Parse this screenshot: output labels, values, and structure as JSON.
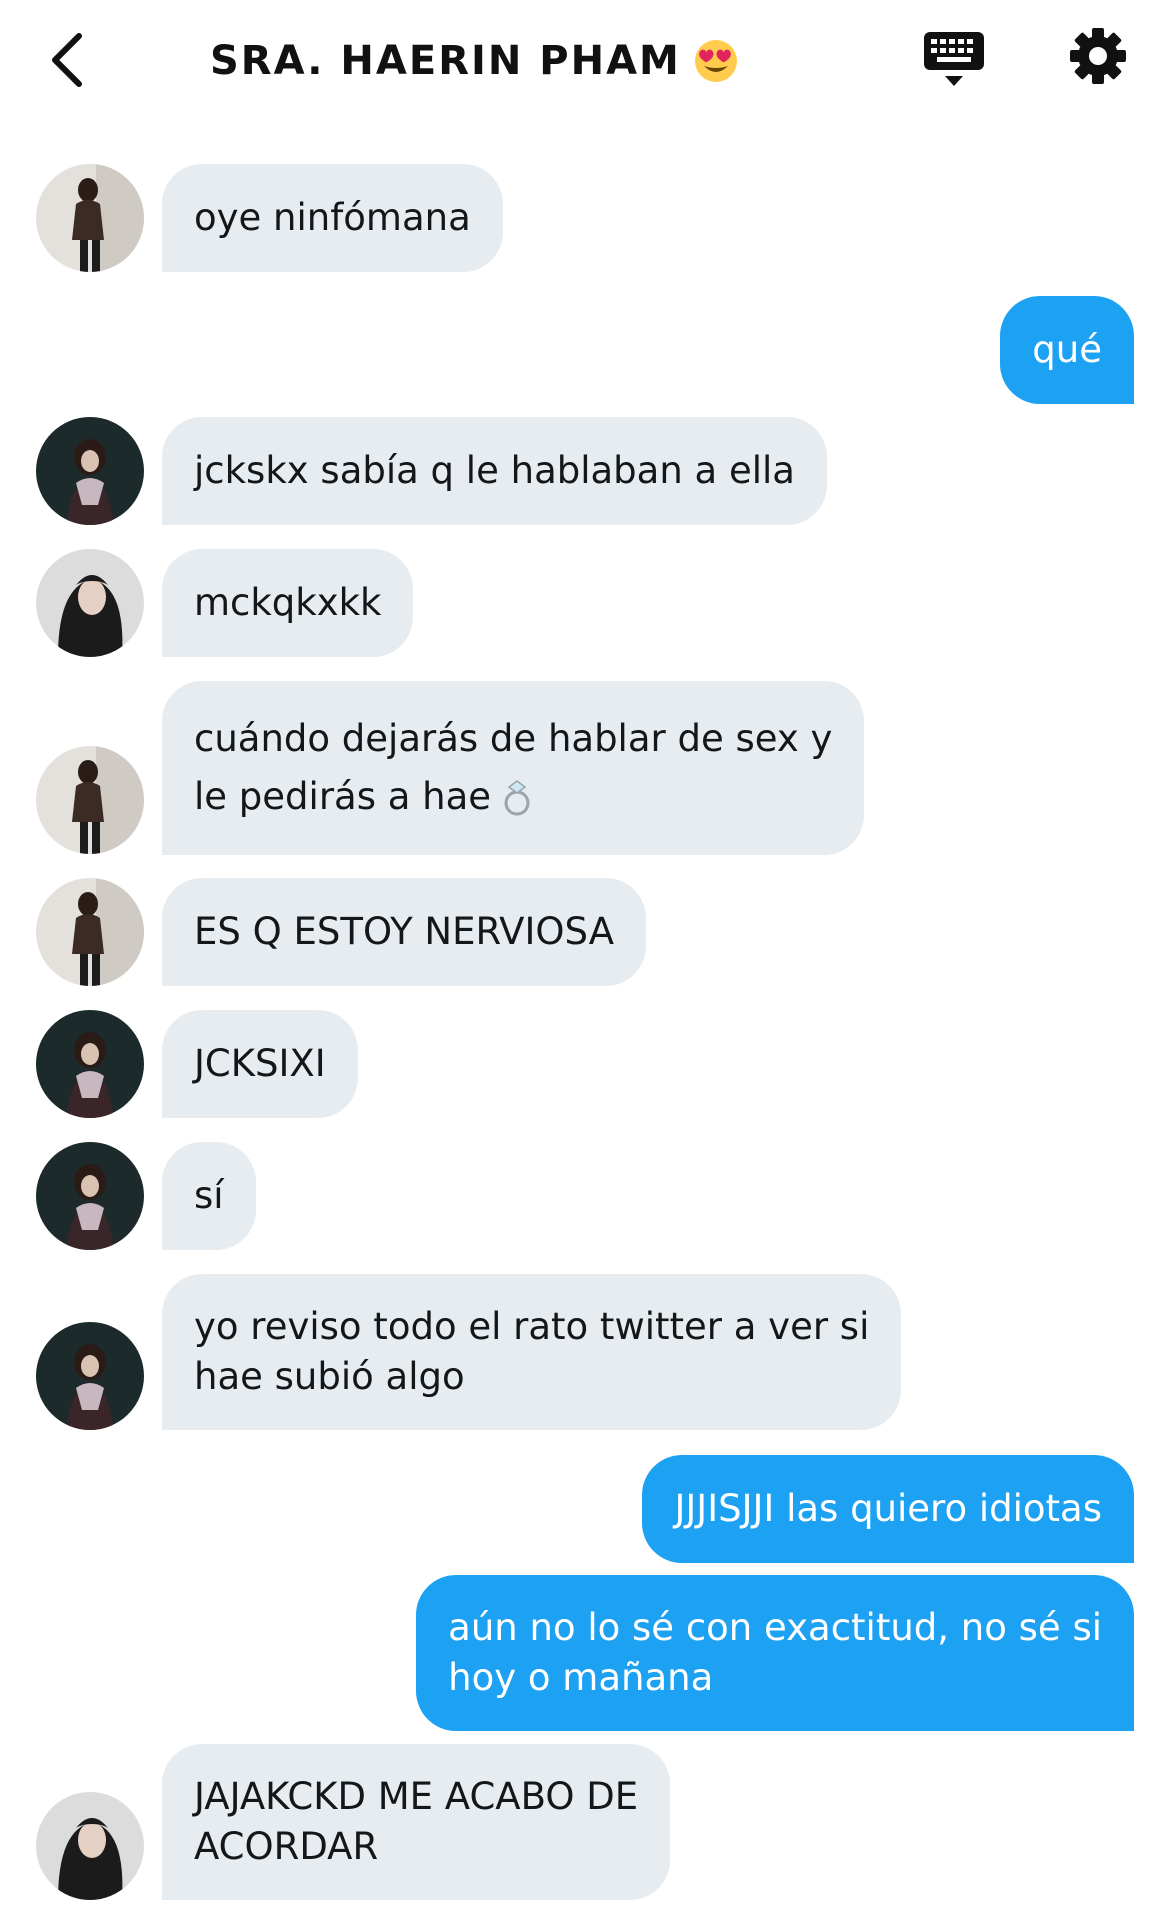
{
  "header": {
    "title": "SRA. HAERIN PHAM",
    "icons": {
      "back": "back-arrow-icon",
      "title_emoji": "heart-eyes-emoji-icon",
      "keyboard": "keyboard-icon",
      "settings": "gear-icon"
    }
  },
  "colors": {
    "incoming_bubble": "#e6ecf0",
    "outgoing_bubble": "#1da1f2",
    "incoming_text": "#14171a",
    "outgoing_text": "#ffffff"
  },
  "messages": [
    {
      "direction": "in",
      "avatar": "avatar-long-hair-standing",
      "text": "oye ninfómana"
    },
    {
      "direction": "out",
      "text": "qué"
    },
    {
      "direction": "in",
      "avatar": "avatar-dark-scarf",
      "text": "jckskx sabía q le hablaban a ella"
    },
    {
      "direction": "in",
      "avatar": "avatar-portrait-closeup",
      "text": "mckqkxkk"
    },
    {
      "direction": "in",
      "avatar": "avatar-long-hair-standing",
      "text_line1": "cuándo dejarás de hablar de sex y",
      "text_line2": "le pedirás a hae",
      "emoji": "ring-icon"
    },
    {
      "direction": "in",
      "avatar": "avatar-long-hair-standing",
      "text": "ES Q ESTOY NERVIOSA"
    },
    {
      "direction": "in",
      "avatar": "avatar-dark-scarf",
      "text": "JCKSIXI"
    },
    {
      "direction": "in",
      "avatar": "avatar-dark-scarf",
      "text": "sí"
    },
    {
      "direction": "in",
      "avatar": "avatar-dark-scarf",
      "text": "yo reviso todo el rato twitter a ver si\nhae subió algo"
    },
    {
      "direction": "out",
      "text": "JJJISJJI las quiero idiotas"
    },
    {
      "direction": "out",
      "text": "aún no lo sé con exactitud, no sé si\nhoy o mañana"
    },
    {
      "direction": "in",
      "avatar": "avatar-portrait-closeup",
      "text": "JAJAKCKD ME ACABO DE\nACORDAR"
    }
  ]
}
